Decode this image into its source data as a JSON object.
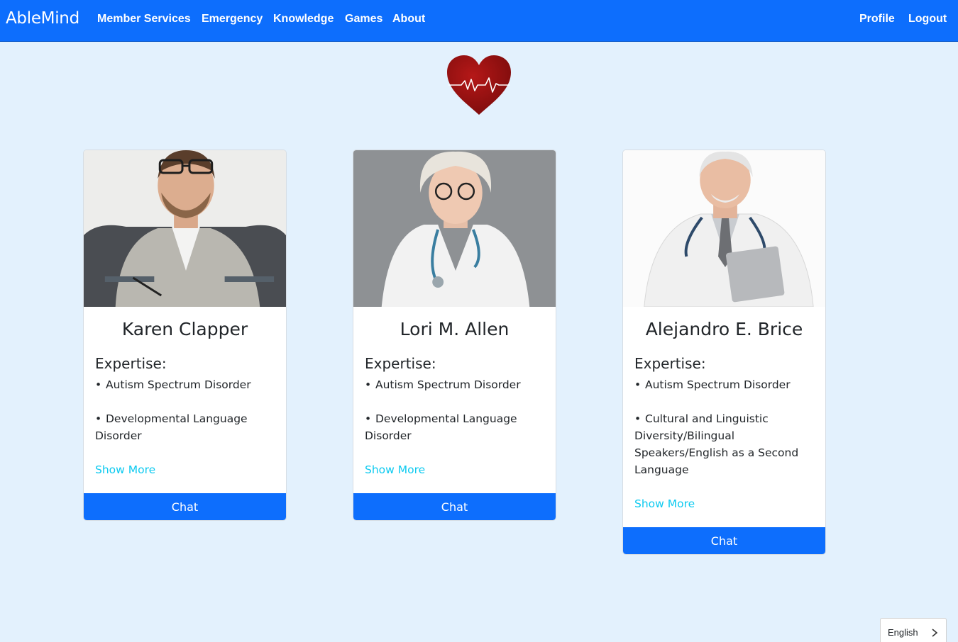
{
  "nav": {
    "brand": "AbleMind",
    "links": [
      "Member Services",
      "Emergency",
      "Knowledge",
      "Games",
      "About"
    ],
    "right_links": [
      "Profile",
      "Logout"
    ]
  },
  "logo": {
    "icon": "heartbeat-heart-icon",
    "color": "#9b1212"
  },
  "expertise_label": "Expertise:",
  "therapists": [
    {
      "name": "Karen Clapper",
      "expertise": [
        "Autism Spectrum Disorder",
        "Developmental Language Disorder"
      ],
      "show_more": "Show More",
      "chat": "Chat"
    },
    {
      "name": "Lori M. Allen",
      "expertise": [
        "Autism Spectrum Disorder",
        "Developmental Language Disorder"
      ],
      "show_more": "Show More",
      "chat": "Chat"
    },
    {
      "name": "Alejandro E. Brice",
      "expertise": [
        "Autism Spectrum Disorder",
        "Cultural and Linguistic Diversity/Bilingual Speakers/English as a Second Language"
      ],
      "show_more": "Show More",
      "chat": "Chat"
    }
  ],
  "language": {
    "selected": "English",
    "icon": "chevron-right-icon"
  },
  "colors": {
    "primary": "#0d6efd",
    "background": "#e3f1fd",
    "link": "#0dcaf0"
  }
}
